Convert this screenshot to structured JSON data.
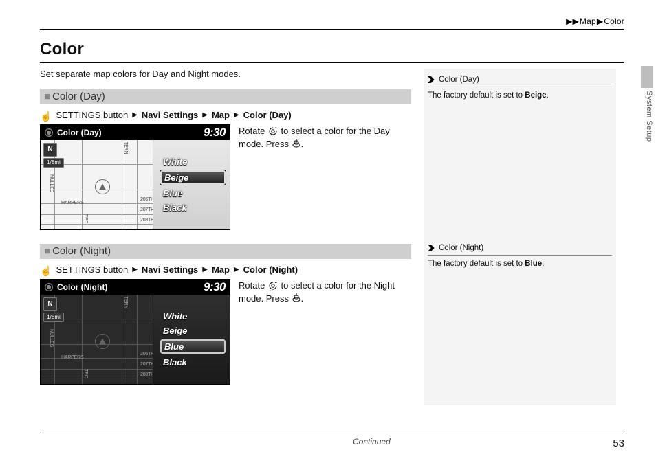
{
  "breadcrumb": {
    "item1": "Map",
    "item2": "Color"
  },
  "page_title": "Color",
  "intro": "Set separate map colors for Day and Night modes.",
  "section_day": {
    "heading": "Color (Day)",
    "path": {
      "p0": "SETTINGS button",
      "p1": "Navi Settings",
      "p2": "Map",
      "p3": "Color (Day)"
    },
    "screen": {
      "title": "Color (Day)",
      "clock": "9:30",
      "compass": "N",
      "scale": "1/8mi",
      "options": [
        "White",
        "Beige",
        "Blue",
        "Black"
      ],
      "selected_index": 1,
      "roads": {
        "harpers": "HARPERS",
        "r206": "206TH",
        "r207": "207TH",
        "r208": "208TH",
        "tern": "TERN",
        "nulles": "NULLES",
        "tec": "TEC"
      }
    },
    "instruction_a": "Rotate ",
    "instruction_b": " to select a color for the Day mode. Press ",
    "instruction_c": "."
  },
  "section_night": {
    "heading": "Color (Night)",
    "path": {
      "p0": "SETTINGS button",
      "p1": "Navi Settings",
      "p2": "Map",
      "p3": "Color (Night)"
    },
    "screen": {
      "title": "Color (Night)",
      "clock": "9:30",
      "compass": "N",
      "scale": "1/8mi",
      "options": [
        "White",
        "Beige",
        "Blue",
        "Black"
      ],
      "selected_index": 2,
      "roads": {
        "harpers": "HARPERS",
        "r206": "206TH",
        "r207": "207TH",
        "r208": "208TH",
        "tern": "TERN",
        "nulles": "NULLES",
        "tec": "TEC"
      }
    },
    "instruction_a": "Rotate ",
    "instruction_b": " to select a color for the Night mode. Press ",
    "instruction_c": "."
  },
  "sidebar": {
    "day": {
      "title": "Color (Day)",
      "prefix": "The factory default is set to ",
      "value": "Beige",
      "suffix": "."
    },
    "night": {
      "title": "Color (Night)",
      "prefix": "The factory default is set to ",
      "value": "Blue",
      "suffix": "."
    }
  },
  "side_label": "System Setup",
  "footer": {
    "continued": "Continued",
    "page": "53"
  }
}
